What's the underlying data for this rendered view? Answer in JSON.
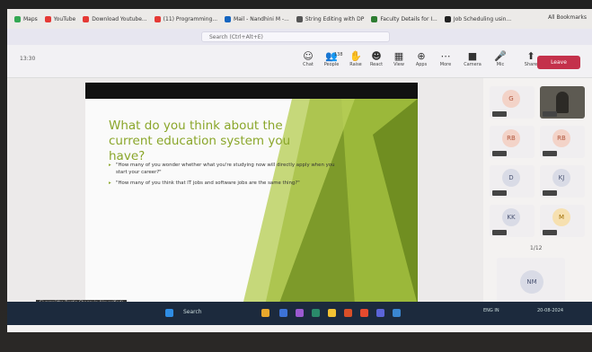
{
  "browser": {
    "bookmarks": [
      {
        "label": "Maps",
        "color": "#34a853"
      },
      {
        "label": "YouTube",
        "color": "#e53935"
      },
      {
        "label": "Download Youtube...",
        "color": "#e53935"
      },
      {
        "label": "(11) Programming...",
        "color": "#e53935"
      },
      {
        "label": "Mail - Nandhini M -...",
        "color": "#1565c0"
      },
      {
        "label": "String Editing with DP",
        "color": "#555555"
      },
      {
        "label": "Faculty Details for I...",
        "color": "#2e7d32"
      },
      {
        "label": "Job Scheduling usin...",
        "color": "#222222"
      }
    ],
    "all_bookmarks": "All Bookmarks"
  },
  "search": {
    "placeholder": "Search (Ctrl+Alt+E)"
  },
  "meeting": {
    "timer": "13:30",
    "tools": [
      {
        "label": "Chat",
        "icon": "chat-icon",
        "glyph": "☺"
      },
      {
        "label": "People",
        "icon": "people-icon",
        "glyph": "👥",
        "count": "138"
      },
      {
        "label": "Raise",
        "icon": "hand-icon",
        "glyph": "✋"
      },
      {
        "label": "React",
        "icon": "smile-icon",
        "glyph": "☻"
      },
      {
        "label": "View",
        "icon": "grid-icon",
        "glyph": "▦"
      },
      {
        "label": "Apps",
        "icon": "plus-icon",
        "glyph": "⊕"
      },
      {
        "label": "More",
        "icon": "more-icon",
        "glyph": "⋯"
      },
      {
        "label": "Camera",
        "icon": "camera-icon",
        "glyph": "■"
      },
      {
        "label": "Mic",
        "icon": "mic-icon",
        "glyph": "🎤"
      },
      {
        "label": "Share",
        "icon": "share-icon",
        "glyph": "⬆"
      }
    ],
    "leave_label": "Leave"
  },
  "slide": {
    "title": "What do you think about the current education system you have?",
    "bullets": [
      "\"How many of you wonder whether what you're studying now will directly apply when you start your career?\"",
      "\"How many of you think that IT jobs and software jobs are the same thing?\""
    ],
    "presenter": "Sivaranjitha Bestin Chagavin (Unverified)",
    "accent": "#8aa62a"
  },
  "participants": [
    {
      "initials": "G",
      "bg": "#f3d3c8",
      "fg": "#b0543a"
    },
    {
      "initials": "",
      "bg": "#5d5a52",
      "fg": "#ffffff"
    },
    {
      "initials": "RB",
      "bg": "#f3d3c8",
      "fg": "#b0543a"
    },
    {
      "initials": "RB",
      "bg": "#f3d3c8",
      "fg": "#b0543a"
    },
    {
      "initials": "D",
      "bg": "#d9dbe6",
      "fg": "#4b5473"
    },
    {
      "initials": "KJ",
      "bg": "#d9dbe6",
      "fg": "#4b5473"
    },
    {
      "initials": "KK",
      "bg": "#d9dbe6",
      "fg": "#4b5473"
    },
    {
      "initials": "M",
      "bg": "#f6e0b0",
      "fg": "#a06d00"
    }
  ],
  "pager": "1/12",
  "featured": {
    "initials": "NM"
  },
  "taskbar": {
    "search_label": "Search",
    "tray_lang": "ENG IN",
    "date": "20-08-2024"
  }
}
